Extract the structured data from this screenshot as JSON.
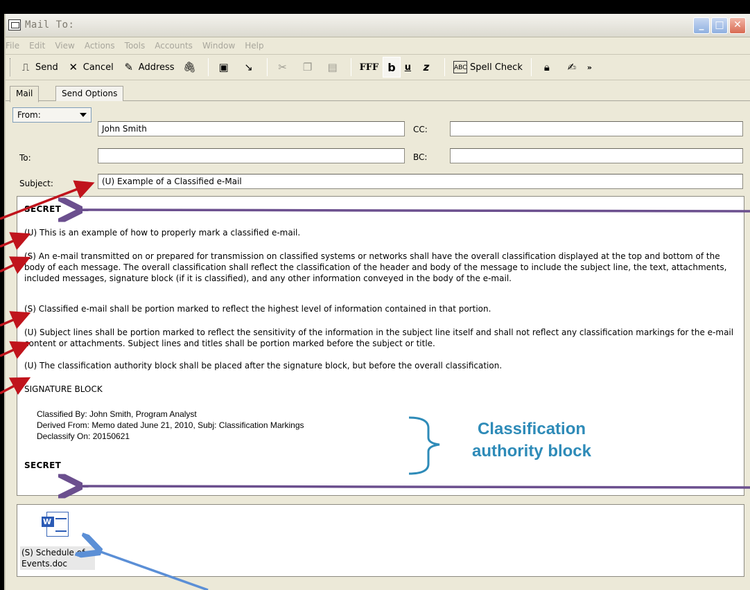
{
  "window": {
    "title": "Mail To:",
    "menu": [
      "File",
      "Edit",
      "View",
      "Actions",
      "Tools",
      "Accounts",
      "Window",
      "Help"
    ]
  },
  "toolbar": {
    "send_label": "Send",
    "cancel_label": "Cancel",
    "address_label": "Address",
    "fff_label": "FFF",
    "bold_label": "b",
    "underline_label": "u",
    "spell_check_label": "Spell Check"
  },
  "tabs": [
    "Mail",
    "Send Options"
  ],
  "header": {
    "from_label": "From:",
    "from_value": "John Smith",
    "to_label": "To:",
    "to_value": "",
    "subject_label": "Subject:",
    "subject_value": "(U) Example of a Classified e-Mail",
    "cc_label": "CC:",
    "cc_value": "",
    "bc_label": "BC:",
    "bc_value": ""
  },
  "body": {
    "top_banner": "SECRET",
    "p1": "(U) This is an example of how to properly mark a classified e-mail.",
    "p2": "(S) An e-mail transmitted on or prepared for transmission on classified systems or networks shall have the overall classification displayed at the top and bottom of the body of each message.  The overall classification shall reflect the classification of the header and body of the message to include the subject line, the text, attachments, included messages, signature block (if it is classified), and any other information conveyed in the body of the e-mail.",
    "p3": "(S) Classified e-mail shall be portion marked to reflect the highest level of information contained in that portion.",
    "p4": "(U) Subject lines shall be portion marked to reflect the sensitivity of the information in the subject line itself and shall not reflect any classification markings for the e-mail content or attachments.  Subject lines and titles shall be portion marked before the subject or title.",
    "p5": "(U) The classification authority block shall be placed after the signature block, but before the overall classification.",
    "signature": "SIGNATURE BLOCK",
    "classified_by": "Classified By:  John Smith, Program Analyst",
    "derived_from": "Derived From:   Memo dated June 21, 2010, Subj:  Classification Markings",
    "declassify_on": "Declassify On:  20150621",
    "bottom_banner": "SECRET"
  },
  "attachment": {
    "name": "(S) Schedule of Events.doc"
  },
  "annotation": {
    "line1": "Classification",
    "line2": "authority block"
  },
  "colors": {
    "red_arrow": "#c0141c",
    "purple_arrow": "#6b4f8e",
    "blue_arrow": "#5b8fd6",
    "annotation_text": "#2e8bb8"
  }
}
